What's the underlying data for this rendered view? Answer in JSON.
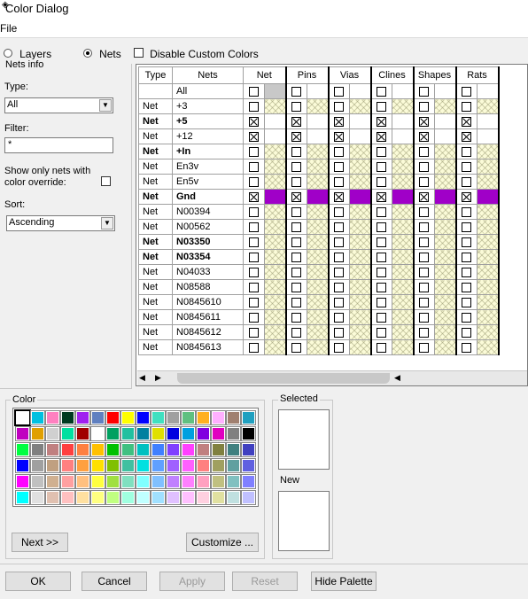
{
  "window": {
    "title": "Color Dialog"
  },
  "menu": {
    "file": "File"
  },
  "mode": {
    "layers": "Layers",
    "nets": "Nets",
    "selected": "nets",
    "disable_custom": "Disable Custom Colors"
  },
  "nets_info": {
    "legend": "Nets info",
    "type_label": "Type:",
    "type_value": "All",
    "filter_label": "Filter:",
    "filter_value": "*",
    "override_label_1": "Show only nets with",
    "override_label_2": "color override:",
    "sort_label": "Sort:",
    "sort_value": "Ascending"
  },
  "grid": {
    "headers": [
      "Type",
      "Nets",
      "Net",
      "Pins",
      "Vias",
      "Clines",
      "Shapes",
      "Rats"
    ],
    "rows": [
      {
        "type": "",
        "name": "All",
        "bold": false,
        "checks": [
          false,
          false,
          false,
          false,
          false,
          false
        ],
        "color": "all"
      },
      {
        "type": "Net",
        "name": "+3",
        "bold": false,
        "checks": [
          false,
          false,
          false,
          false,
          false,
          false
        ],
        "color": "none"
      },
      {
        "type": "Net",
        "name": "+5",
        "bold": true,
        "checks": [
          true,
          true,
          true,
          true,
          true,
          true
        ],
        "color": "white"
      },
      {
        "type": "Net",
        "name": "+12",
        "bold": false,
        "checks": [
          true,
          true,
          true,
          true,
          true,
          true
        ],
        "color": "white"
      },
      {
        "type": "Net",
        "name": "+In",
        "bold": true,
        "checks": [
          false,
          false,
          false,
          false,
          false,
          false
        ],
        "color": "none"
      },
      {
        "type": "Net",
        "name": "En3v",
        "bold": false,
        "checks": [
          false,
          false,
          false,
          false,
          false,
          false
        ],
        "color": "none"
      },
      {
        "type": "Net",
        "name": "En5v",
        "bold": false,
        "checks": [
          false,
          false,
          false,
          false,
          false,
          false
        ],
        "color": "none"
      },
      {
        "type": "Net",
        "name": "Gnd",
        "bold": true,
        "checks": [
          true,
          true,
          true,
          true,
          true,
          true
        ],
        "color": "purple"
      },
      {
        "type": "Net",
        "name": "N00394",
        "bold": false,
        "checks": [
          false,
          false,
          false,
          false,
          false,
          false
        ],
        "color": "none"
      },
      {
        "type": "Net",
        "name": "N00562",
        "bold": false,
        "checks": [
          false,
          false,
          false,
          false,
          false,
          false
        ],
        "color": "none"
      },
      {
        "type": "Net",
        "name": "N03350",
        "bold": true,
        "checks": [
          false,
          false,
          false,
          false,
          false,
          false
        ],
        "color": "none"
      },
      {
        "type": "Net",
        "name": "N03354",
        "bold": true,
        "checks": [
          false,
          false,
          false,
          false,
          false,
          false
        ],
        "color": "none"
      },
      {
        "type": "Net",
        "name": "N04033",
        "bold": false,
        "checks": [
          false,
          false,
          false,
          false,
          false,
          false
        ],
        "color": "none"
      },
      {
        "type": "Net",
        "name": "N08588",
        "bold": false,
        "checks": [
          false,
          false,
          false,
          false,
          false,
          false
        ],
        "color": "none"
      },
      {
        "type": "Net",
        "name": "N0845610",
        "bold": false,
        "checks": [
          false,
          false,
          false,
          false,
          false,
          false
        ],
        "color": "none"
      },
      {
        "type": "Net",
        "name": "N0845611",
        "bold": false,
        "checks": [
          false,
          false,
          false,
          false,
          false,
          false
        ],
        "color": "none"
      },
      {
        "type": "Net",
        "name": "N0845612",
        "bold": false,
        "checks": [
          false,
          false,
          false,
          false,
          false,
          false
        ],
        "color": "none"
      },
      {
        "type": "Net",
        "name": "N0845613",
        "bold": false,
        "checks": [
          false,
          false,
          false,
          false,
          false,
          false
        ],
        "color": "none"
      }
    ]
  },
  "palette": {
    "legend": "Color",
    "selected_legend": "Selected",
    "new_legend": "New",
    "next_label": "Next >>",
    "customize_label": "Customize ...",
    "colors": [
      [
        "#ffffff",
        "#00c0e0",
        "#ff80c0",
        "#003a20",
        "#a020f0",
        "#6080c0",
        "#ff0000",
        "#ffff00",
        "#0000ff",
        "#40e0c0",
        "#a0a0a0",
        "#60c080",
        "#ffb020",
        "#ffb0ff",
        "#a08070",
        "#20a0c0"
      ],
      [
        "#c000c0",
        "#e0a000",
        "#d0d0d0",
        "#00e0a0",
        "#a00000",
        "#ffffff",
        "#00a060",
        "#20c0a0",
        "#0080a0",
        "#e0e000",
        "#0000e0",
        "#00a0e0",
        "#8000e0",
        "#e000c0",
        "#808080",
        "#000000"
      ],
      [
        "#00ff40",
        "#808080",
        "#c08080",
        "#ff4040",
        "#ff8040",
        "#ffc000",
        "#00c000",
        "#40c080",
        "#00c0c0",
        "#4080ff",
        "#8040ff",
        "#ff40ff",
        "#c08080",
        "#808040",
        "#408080",
        "#4040c0"
      ],
      [
        "#0000ff",
        "#a0a0a0",
        "#c0a080",
        "#ff8080",
        "#ffa040",
        "#ffe000",
        "#80c000",
        "#40c0a0",
        "#00e0e0",
        "#60a0ff",
        "#a060ff",
        "#ff60ff",
        "#ff8080",
        "#a0a060",
        "#60a0a0",
        "#6060e0"
      ],
      [
        "#ff00ff",
        "#c0c0c0",
        "#d0b090",
        "#ffa0a0",
        "#ffc080",
        "#ffff40",
        "#a0e040",
        "#80e0c0",
        "#80ffff",
        "#80c0ff",
        "#c080ff",
        "#ff80ff",
        "#ffa0c0",
        "#c0c080",
        "#80c0c0",
        "#8080ff"
      ],
      [
        "#00ffff",
        "#e0e0e0",
        "#e0c0b0",
        "#ffc0c0",
        "#ffe0a0",
        "#ffff80",
        "#c0ff80",
        "#a0ffe0",
        "#c0ffff",
        "#a0e0ff",
        "#e0c0ff",
        "#ffc0ff",
        "#ffd0e0",
        "#e0e0a0",
        "#c0e0e0",
        "#c0c0ff"
      ]
    ]
  },
  "buttons": {
    "ok": "OK",
    "cancel": "Cancel",
    "apply": "Apply",
    "reset": "Reset",
    "hide_palette": "Hide Palette"
  }
}
